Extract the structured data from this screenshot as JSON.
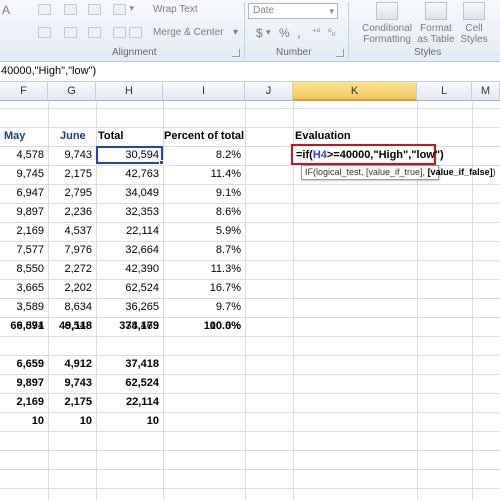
{
  "ribbon": {
    "wrap_text": "Wrap Text",
    "merge_center": "Merge & Center",
    "number_format": "Date",
    "currency_symbol": "$",
    "percent_symbol": "%",
    "comma_symbol": ",",
    "conditional_formatting": [
      "Conditional",
      "Formatting"
    ],
    "format_as_table": [
      "Format",
      "as Table"
    ],
    "cell_styles": [
      "Cell",
      "Styles"
    ],
    "groups": {
      "alignment": "Alignment",
      "number": "Number",
      "styles": "Styles"
    }
  },
  "formula_bar": {
    "text": "40000,\"High\",\"low\")"
  },
  "columns": [
    "F",
    "G",
    "H",
    "I",
    "J",
    "K",
    "L",
    "M"
  ],
  "active_column": "K",
  "table": {
    "headers": {
      "may": "May",
      "june": "June",
      "total": "Total",
      "percent": "Percent of total",
      "evaluation": "Evaluation"
    },
    "rows": [
      {
        "may": "4,578",
        "june": "9,743",
        "total": "30,594",
        "percent": "8.2%"
      },
      {
        "may": "9,745",
        "june": "2,175",
        "total": "42,763",
        "percent": "11.4%"
      },
      {
        "may": "6,947",
        "june": "2,795",
        "total": "34,049",
        "percent": "9.1%"
      },
      {
        "may": "9,897",
        "june": "2,236",
        "total": "32,353",
        "percent": "8.6%"
      },
      {
        "may": "2,169",
        "june": "4,537",
        "total": "22,114",
        "percent": "5.9%"
      },
      {
        "may": "7,577",
        "june": "7,976",
        "total": "32,664",
        "percent": "8.7%"
      },
      {
        "may": "8,550",
        "june": "2,272",
        "total": "42,390",
        "percent": "11.3%"
      },
      {
        "may": "3,665",
        "june": "2,202",
        "total": "62,524",
        "percent": "16.7%"
      },
      {
        "may": "3,589",
        "june": "8,634",
        "total": "36,265",
        "percent": "9.7%"
      },
      {
        "may": "9,874",
        "june": "6,548",
        "total": "38,463",
        "percent": "10.3%"
      }
    ],
    "sum_row": {
      "may": "66,591",
      "june": "49,118",
      "total": "374,179",
      "percent": "100.0%"
    },
    "stats": [
      {
        "may": "6,659",
        "june": "4,912",
        "total": "37,418"
      },
      {
        "may": "9,897",
        "june": "9,743",
        "total": "62,524"
      },
      {
        "may": "2,169",
        "june": "2,175",
        "total": "22,114"
      },
      {
        "may": "10",
        "june": "10",
        "total": "10"
      }
    ]
  },
  "formula_edit": {
    "prefix": "=if(",
    "ref": "H4",
    "rest": ">=40000,\"High\",\"low\")"
  },
  "tooltip": {
    "fn": "IF(logical_test, [value_if_true], ",
    "current_arg": "[value_if_false]",
    "close": ")"
  }
}
